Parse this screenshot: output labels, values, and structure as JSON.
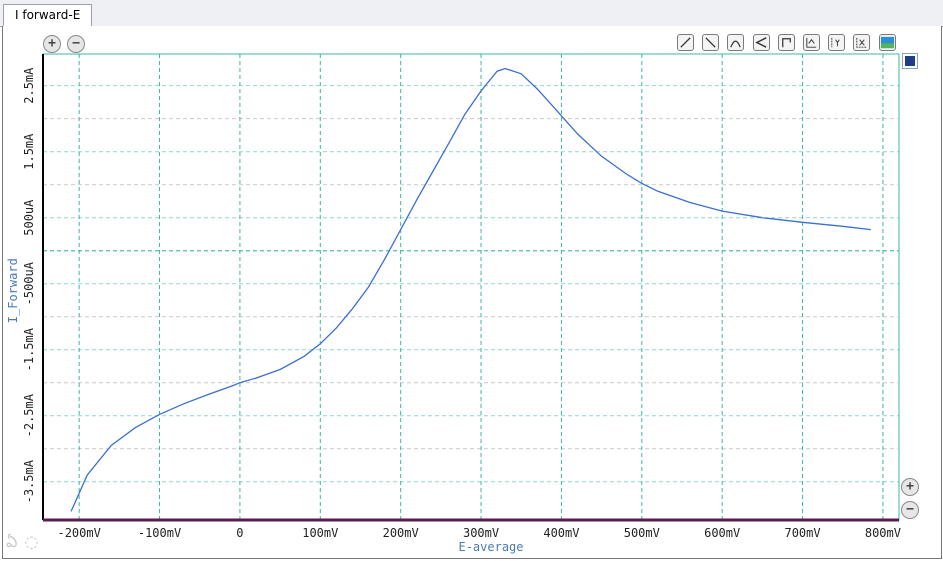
{
  "window": {
    "tab_label": "I forward-E"
  },
  "colors": {
    "plot_line": "#3b6fd1",
    "grid_major": "#39b8a8",
    "grid_minor": "#c9c9c9",
    "axis_label": "#4a7bb7",
    "tick_label": "#222222",
    "bottom_axis": "#5a1b4d"
  },
  "toolbar": {
    "icons": [
      "line-up-icon",
      "line-down-icon",
      "peak-icon",
      "bracket-icon",
      "step-icon",
      "xy-zoom-icon",
      "y-zoom-icon",
      "x-zoom-icon",
      "image-icon"
    ]
  },
  "chart_data": {
    "type": "line",
    "xlabel": "E-average",
    "ylabel": "I_Forward",
    "x_unit": "mV",
    "y_unit": "mA",
    "xlim": [
      -245,
      820
    ],
    "ylim": [
      -4.08,
      2.98
    ],
    "x_ticks": [
      -200,
      -100,
      0,
      100,
      200,
      300,
      400,
      500,
      600,
      700,
      800
    ],
    "x_tick_labels": [
      "-200mV",
      "-100mV",
      "0",
      "100mV",
      "200mV",
      "300mV",
      "400mV",
      "500mV",
      "600mV",
      "700mV",
      "800mV"
    ],
    "y_ticks": [
      2.5,
      1.5,
      0.5,
      -0.5,
      -1.5,
      -2.5,
      -3.5
    ],
    "y_tick_labels": [
      "2.5mA",
      "1.5mA",
      "500uA",
      "-500uA",
      "-1.5mA",
      "-2.5mA",
      "-3.5mA"
    ],
    "grid": true,
    "legend": "top-right",
    "series": [
      {
        "x": [
          -210,
          -190,
          -160,
          -130,
          -100,
          -70,
          -40,
          -10,
          0,
          20,
          50,
          80,
          100,
          120,
          140,
          160,
          180,
          200,
          220,
          240,
          260,
          280,
          300,
          320,
          330,
          350,
          370,
          390,
          420,
          450,
          480,
          500,
          520,
          560,
          600,
          650,
          700,
          750,
          785
        ],
        "y": [
          -3.95,
          -3.4,
          -2.95,
          -2.68,
          -2.48,
          -2.32,
          -2.18,
          -2.05,
          -2.0,
          -1.93,
          -1.8,
          -1.6,
          -1.41,
          -1.17,
          -0.88,
          -0.55,
          -0.13,
          0.32,
          0.77,
          1.2,
          1.63,
          2.07,
          2.42,
          2.72,
          2.76,
          2.68,
          2.45,
          2.18,
          1.77,
          1.43,
          1.17,
          1.02,
          0.9,
          0.73,
          0.6,
          0.5,
          0.43,
          0.37,
          0.32
        ]
      }
    ]
  }
}
